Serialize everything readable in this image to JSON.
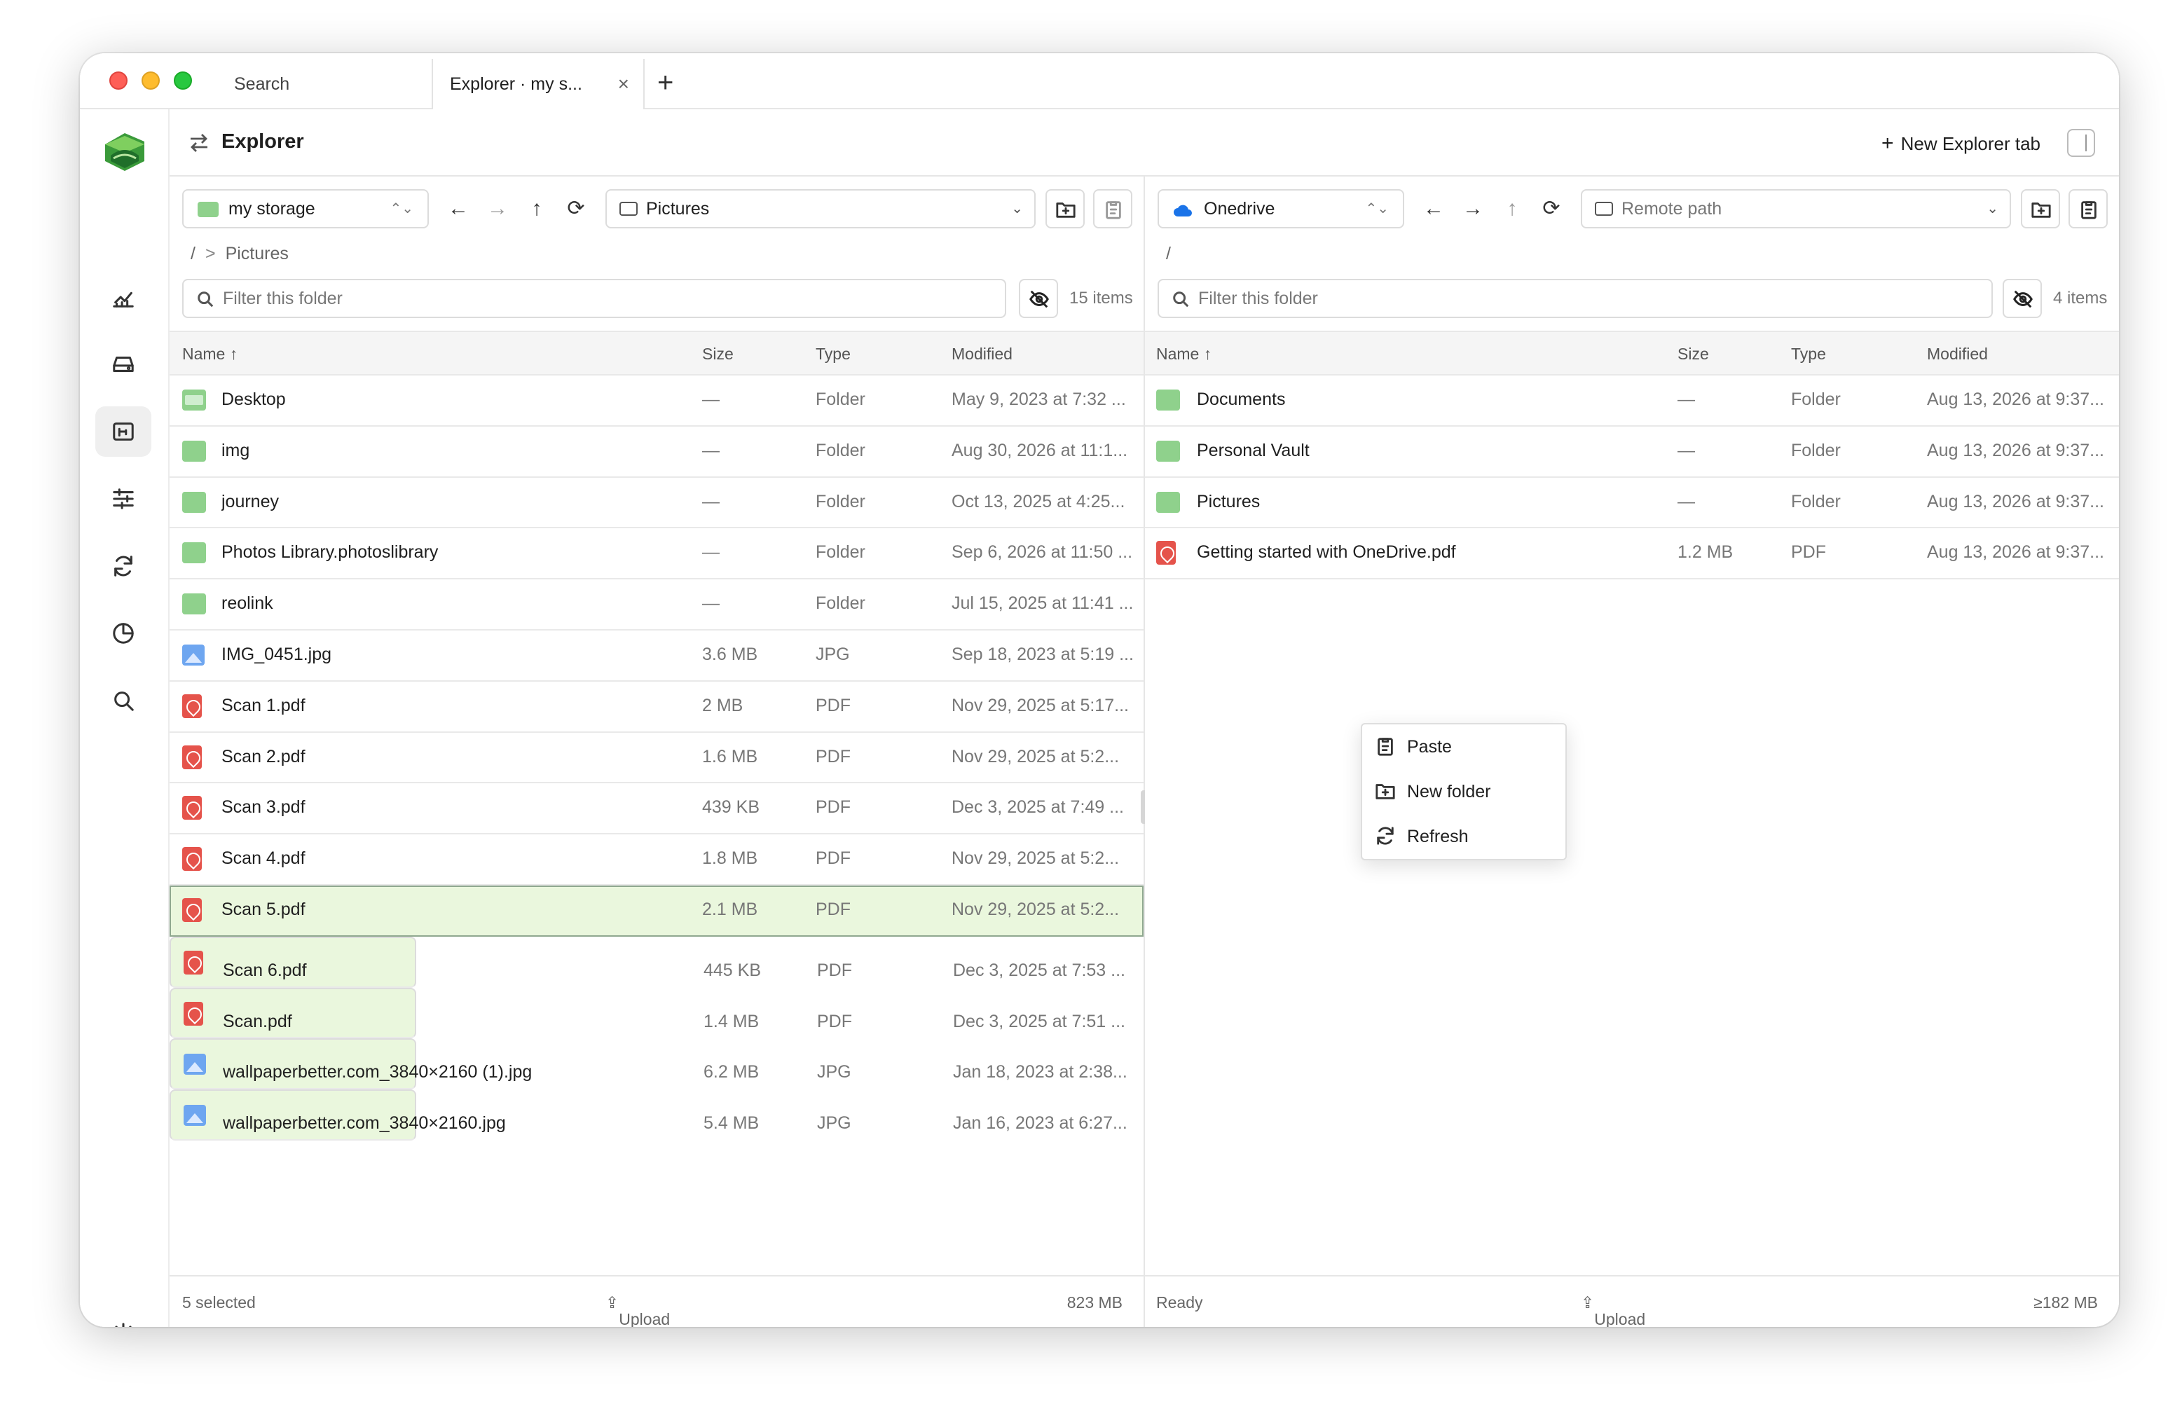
{
  "tabs": {
    "search": "Search",
    "explorer": "Explorer · my s...",
    "close": "×",
    "add": "+"
  },
  "header": {
    "title": "Explorer",
    "new_tab": "New Explorer tab"
  },
  "left": {
    "storage": "my storage",
    "path": "Pictures",
    "breadcrumb_root": "/",
    "breadcrumb_sep": ">",
    "breadcrumb_current": "Pictures",
    "filter_placeholder": "Filter this folder",
    "count": "15 items",
    "columns": {
      "name": "Name ↑",
      "size": "Size",
      "type": "Type",
      "modified": "Modified"
    },
    "rows": [
      {
        "icon": "desktop-folder",
        "name": "Desktop",
        "size": "—",
        "type": "Folder",
        "modified": "May 9, 2023 at 7:32 ..."
      },
      {
        "icon": "folder",
        "name": "img",
        "size": "—",
        "type": "Folder",
        "modified": "Aug 30, 2026 at 11:1..."
      },
      {
        "icon": "folder",
        "name": "journey",
        "size": "—",
        "type": "Folder",
        "modified": "Oct 13, 2025 at 4:25..."
      },
      {
        "icon": "folder",
        "name": "Photos Library.photoslibrary",
        "size": "—",
        "type": "Folder",
        "modified": "Sep 6, 2026 at 11:50 ..."
      },
      {
        "icon": "folder",
        "name": "reolink",
        "size": "—",
        "type": "Folder",
        "modified": "Jul 15, 2025 at 11:41 ..."
      },
      {
        "icon": "jpg",
        "name": "IMG_0451.jpg",
        "size": "3.6 MB",
        "type": "JPG",
        "modified": "Sep 18, 2023 at 5:19 ..."
      },
      {
        "icon": "pdf",
        "name": "Scan 1.pdf",
        "size": "2 MB",
        "type": "PDF",
        "modified": "Nov 29, 2025 at 5:17..."
      },
      {
        "icon": "pdf",
        "name": "Scan 2.pdf",
        "size": "1.6 MB",
        "type": "PDF",
        "modified": "Nov 29, 2025 at 5:2..."
      },
      {
        "icon": "pdf",
        "name": "Scan 3.pdf",
        "size": "439 KB",
        "type": "PDF",
        "modified": "Dec 3, 2025 at 7:49 ..."
      },
      {
        "icon": "pdf",
        "name": "Scan 4.pdf",
        "size": "1.8 MB",
        "type": "PDF",
        "modified": "Nov 29, 2025 at 5:2..."
      },
      {
        "icon": "pdf",
        "name": "Scan 5.pdf",
        "size": "2.1 MB",
        "type": "PDF",
        "modified": "Nov 29, 2025 at 5:2...",
        "state": "cur"
      },
      {
        "icon": "pdf",
        "name": "Scan 6.pdf",
        "size": "445 KB",
        "type": "PDF",
        "modified": "Dec 3, 2025 at 7:53 ...",
        "state": "sel"
      },
      {
        "icon": "pdf",
        "name": "Scan.pdf",
        "size": "1.4 MB",
        "type": "PDF",
        "modified": "Dec 3, 2025 at 7:51 ...",
        "state": "sel"
      },
      {
        "icon": "jpg",
        "name": "wallpaperbetter.com_3840×2160 (1).jpg",
        "size": "6.2 MB",
        "type": "JPG",
        "modified": "Jan 18, 2023 at 2:38...",
        "state": "sel"
      },
      {
        "icon": "jpg",
        "name": "wallpaperbetter.com_3840×2160.jpg",
        "size": "5.4 MB",
        "type": "JPG",
        "modified": "Jan 16, 2023 at 6:27...",
        "state": "sel"
      }
    ],
    "footer": {
      "status": "5 selected",
      "upload": "Upload file",
      "size": "823 MB"
    }
  },
  "right": {
    "storage": "Onedrive",
    "path_placeholder": "Remote path",
    "breadcrumb_root": "/",
    "filter_placeholder": "Filter this folder",
    "count": "4 items",
    "columns": {
      "name": "Name ↑",
      "size": "Size",
      "type": "Type",
      "modified": "Modified"
    },
    "rows": [
      {
        "icon": "folder",
        "name": "Documents",
        "size": "—",
        "type": "Folder",
        "modified": "Aug 13, 2026 at 9:37..."
      },
      {
        "icon": "folder",
        "name": "Personal Vault",
        "size": "—",
        "type": "Folder",
        "modified": "Aug 13, 2026 at 9:37..."
      },
      {
        "icon": "folder",
        "name": "Pictures",
        "size": "—",
        "type": "Folder",
        "modified": "Aug 13, 2026 at 9:37..."
      },
      {
        "icon": "pdf",
        "name": "Getting started with OneDrive.pdf",
        "size": "1.2 MB",
        "type": "PDF",
        "modified": "Aug 13, 2026 at 9:37..."
      }
    ],
    "footer": {
      "status": "Ready",
      "upload": "Upload file",
      "size": "≥182 MB"
    }
  },
  "context_menu": {
    "paste": "Paste",
    "new_folder": "New folder",
    "refresh": "Refresh"
  },
  "colors": {
    "selection": "#eaf7dd",
    "folder": "#8fd18c",
    "pdf": "#e5534b",
    "image": "#6ea6f0"
  }
}
